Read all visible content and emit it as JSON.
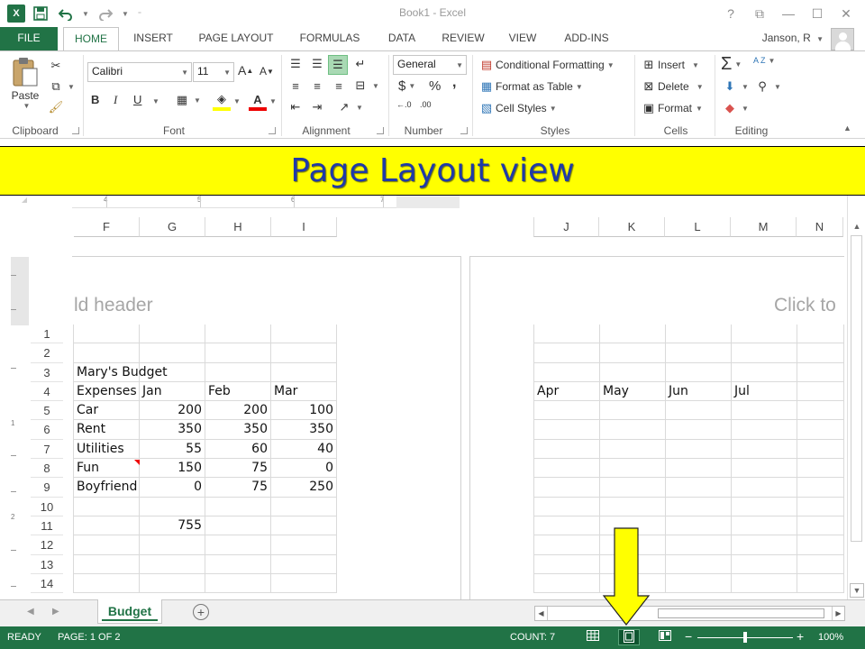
{
  "window": {
    "title": "Book1 - Excel",
    "help": "?",
    "restore_ribbon": "⧉",
    "minimize": "—",
    "maximize": "☐",
    "close": "✕"
  },
  "qat": {
    "logo": "X",
    "save_icon": "save-icon",
    "undo_icon": "undo-icon",
    "redo_icon": "redo-icon"
  },
  "tabs": {
    "file": "FILE",
    "items": [
      "HOME",
      "INSERT",
      "PAGE LAYOUT",
      "FORMULAS",
      "DATA",
      "REVIEW",
      "VIEW",
      "ADD-INS"
    ],
    "active": "HOME"
  },
  "user": {
    "name": "Janson, R"
  },
  "ribbon": {
    "clipboard": {
      "label": "Clipboard",
      "paste": "Paste"
    },
    "font": {
      "label": "Font",
      "name": "Calibri",
      "size": "11",
      "bold": "B",
      "italic": "I",
      "underline": "U",
      "grow": "A",
      "shrink": "A",
      "font_color_letter": "A"
    },
    "alignment": {
      "label": "Alignment"
    },
    "number": {
      "label": "Number",
      "format": "General",
      "currency": "$",
      "percent": "%",
      "comma": ",",
      "inc_dec": "←.0",
      "dec_dec": ".00"
    },
    "styles": {
      "label": "Styles",
      "conditional": "Conditional Formatting",
      "format_table": "Format as Table",
      "cell_styles": "Cell Styles"
    },
    "cells": {
      "label": "Cells",
      "insert": "Insert",
      "delete": "Delete",
      "format": "Format"
    },
    "editing": {
      "label": "Editing",
      "sum": "Σ",
      "sort_az": "A Z"
    }
  },
  "banner": {
    "text": "Page Layout view"
  },
  "ruler": {
    "ticks": [
      "4",
      "5",
      "6",
      "7"
    ],
    "vticks": [
      "1",
      "2"
    ]
  },
  "left_page": {
    "columns": [
      "F",
      "G",
      "H",
      "I"
    ],
    "header_text": "ld header",
    "rows": [
      "1",
      "2",
      "3",
      "4",
      "5",
      "6",
      "7",
      "8",
      "9",
      "10",
      "11",
      "12",
      "13",
      "14"
    ],
    "cells": [
      [
        "",
        "",
        "",
        ""
      ],
      [
        "",
        "",
        "",
        ""
      ],
      [
        "Mary's Budget",
        "",
        "",
        ""
      ],
      [
        "Expenses",
        "Jan",
        "Feb",
        "Mar"
      ],
      [
        "Car",
        "200",
        "200",
        "100"
      ],
      [
        "Rent",
        "350",
        "350",
        "350"
      ],
      [
        "Utilities",
        "55",
        "60",
        "40"
      ],
      [
        "Fun",
        "150",
        "75",
        "0"
      ],
      [
        "Boyfriend",
        "0",
        "75",
        "250"
      ],
      [
        "",
        "",
        "",
        ""
      ],
      [
        "",
        "755",
        "",
        ""
      ],
      [
        "",
        "",
        "",
        ""
      ],
      [
        "",
        "",
        "",
        ""
      ],
      [
        "",
        "",
        "",
        ""
      ]
    ]
  },
  "right_page": {
    "columns": [
      "J",
      "K",
      "L",
      "M",
      "N"
    ],
    "header_text": "Click to",
    "cells": [
      [
        "",
        "",
        "",
        "",
        ""
      ],
      [
        "",
        "",
        "",
        "",
        ""
      ],
      [
        "",
        "",
        "",
        "",
        ""
      ],
      [
        "Apr",
        "May",
        "Jun",
        "Jul",
        ""
      ],
      [
        "",
        "",
        "",
        "",
        ""
      ],
      [
        "",
        "",
        "",
        "",
        ""
      ],
      [
        "",
        "",
        "",
        "",
        ""
      ],
      [
        "",
        "",
        "",
        "",
        ""
      ],
      [
        "",
        "",
        "",
        "",
        ""
      ],
      [
        "",
        "",
        "",
        "",
        ""
      ],
      [
        "",
        "",
        "",
        "",
        ""
      ],
      [
        "",
        "",
        "",
        "",
        ""
      ],
      [
        "",
        "",
        "",
        "",
        ""
      ],
      [
        "",
        "",
        "",
        "",
        ""
      ]
    ]
  },
  "sheets": {
    "active": "Budget",
    "add": "+"
  },
  "status": {
    "mode": "READY",
    "page": "PAGE: 1 OF 2",
    "count": "COUNT: 7",
    "zoom_minus": "−",
    "zoom_plus": "+",
    "zoom": "100%"
  },
  "colors": {
    "excel_green": "#217346",
    "banner_yellow": "#ffff00",
    "banner_text": "#1f3aa8",
    "arrow": "#ffff00"
  }
}
